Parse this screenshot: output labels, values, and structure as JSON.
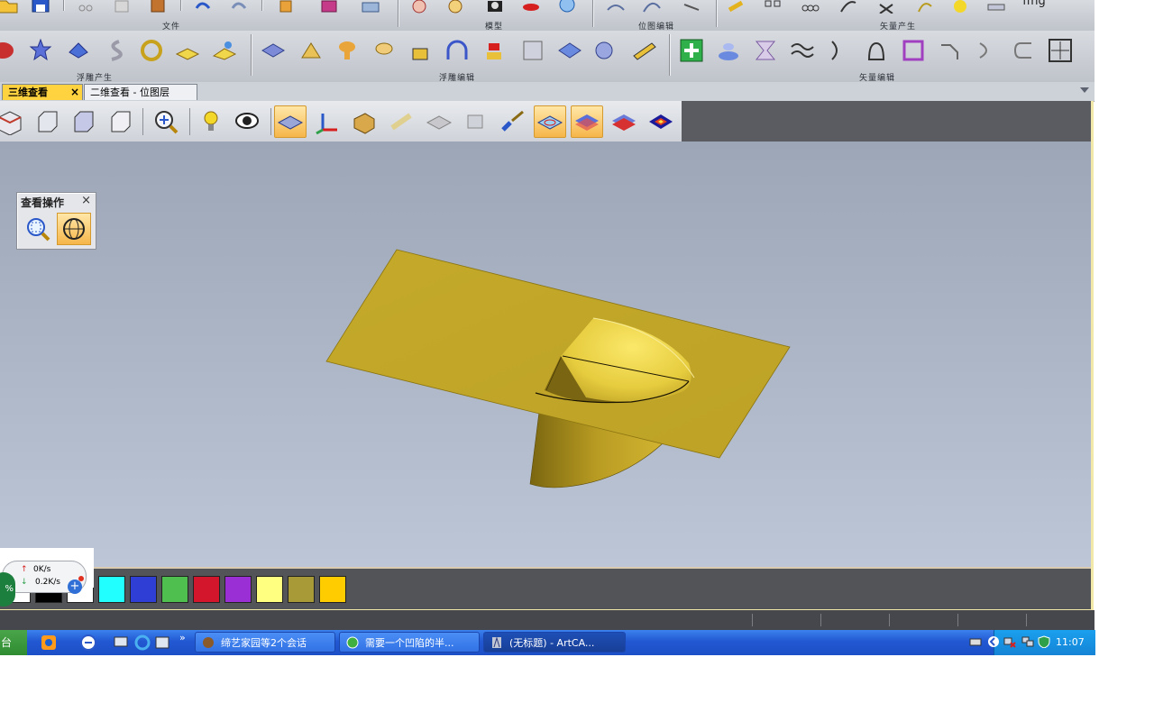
{
  "ribbon": {
    "row1_groups": [
      "文件",
      "模型",
      "位图编辑",
      "矢量产生"
    ],
    "row1_partial_text": "ffng",
    "row2_groups": [
      "浮雕产生",
      "浮雕编辑",
      "矢量编辑"
    ]
  },
  "tabs": [
    {
      "label": "三维查看",
      "active": true,
      "closable": true
    },
    {
      "label": "二维查看 - 位图层",
      "active": false,
      "closable": false
    }
  ],
  "view_panel": {
    "title": "查看操作",
    "close": "×"
  },
  "net_monitor": {
    "percent_glyph": "%",
    "upload": "0K/s",
    "download": "0.2K/s"
  },
  "palette": [
    "#ffffff",
    "#000000",
    "#ffffff",
    "#22ffff",
    "#2f3fd6",
    "#4fbf4f",
    "#d4162c",
    "#9a2fd6",
    "#ffff80",
    "#a99a38",
    "#ffcc00"
  ],
  "taskbar": {
    "start_fragment": "台",
    "overflow": "»",
    "buttons": [
      "缔艺家园等2个会话",
      "需要一个凹陷的半...",
      "(无标题) - ArtCA..."
    ],
    "clock": "11:07"
  },
  "colors": {
    "relief_gold": "#c9b02c",
    "viewport_top": "#9ca6b6",
    "viewport_bottom": "#bcc6d6",
    "active_tab": "#ffd23f",
    "taskbar_blue": "#2258d2"
  }
}
